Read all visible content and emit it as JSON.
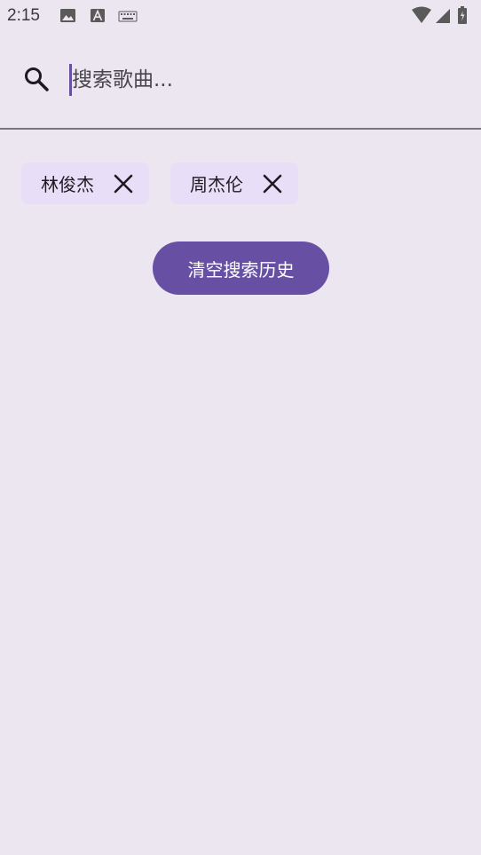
{
  "status_bar": {
    "time": "2:15",
    "left_icons": [
      "image-icon",
      "text-a-icon",
      "keyboard-icon"
    ],
    "right_icons": [
      "wifi-icon",
      "signal-icon",
      "battery-icon"
    ]
  },
  "search": {
    "placeholder": "搜索歌曲...",
    "value": "",
    "icon": "search-icon"
  },
  "history": {
    "items": [
      {
        "label": "林俊杰"
      },
      {
        "label": "周杰伦"
      }
    ]
  },
  "clear_button": {
    "label": "清空搜索历史"
  },
  "colors": {
    "background": "#ECE6F0",
    "primary": "#6750A4",
    "chip": "#E8DEF8",
    "on_surface": "#1D1B20"
  }
}
